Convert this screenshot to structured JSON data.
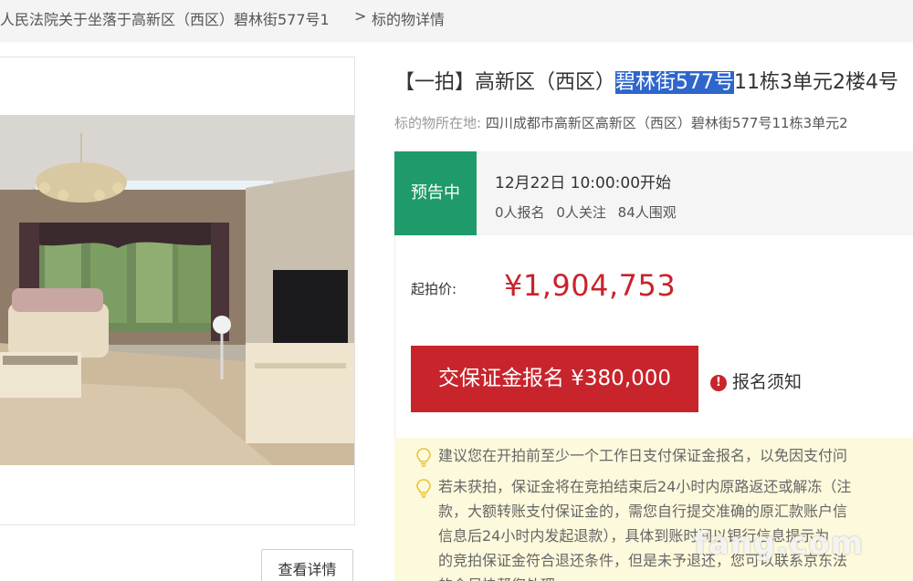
{
  "breadcrumb": {
    "court_item": "人民法院关于坐落于高新区（西区）碧林街577号1",
    "separator": ">",
    "current": "标的物详情"
  },
  "listing": {
    "title_prefix": "【一拍】高新区（西区）",
    "title_highlight": "碧林街577号",
    "title_suffix": "11栋3单元2楼4号",
    "location_label": "标的物所在地:",
    "location_value": "四川成都市高新区高新区（西区）碧林街577号11栋3单元2"
  },
  "status": {
    "badge": "预告中",
    "start_time": "12月22日 10:00:00开始",
    "signups": "0人报名",
    "follows": "0人关注",
    "views": "84人围观",
    "badge_color": "#1f9a6b"
  },
  "price": {
    "label": "起拍价:",
    "value": "¥1,904,753",
    "color": "#c8242c"
  },
  "actions": {
    "deposit_button": "交保证金报名 ¥380,000",
    "notice_link": "报名须知",
    "notice_icon": "exclamation-circle-icon",
    "detail_button": "查看详情"
  },
  "tips": [
    {
      "icon": "lightbulb-icon",
      "lines": [
        "建议您在开拍前至少一个工作日支付保证金报名，以免因支付问"
      ]
    },
    {
      "icon": "lightbulb-icon",
      "lines": [
        "若未获拍，保证金将在竞拍结束后24小时内原路返还或解冻（注",
        "款，大额转账支付保证金的，需您自行提交准确的原汇款账户信",
        "信息后24小时内发起退款），具体到账时间以银行信息提示为",
        "的竞拍保证金符合退还条件，但是未予退还，您可以联系京东法",
        "的会尽快帮您处理"
      ]
    }
  ],
  "watermark": "fang.com"
}
